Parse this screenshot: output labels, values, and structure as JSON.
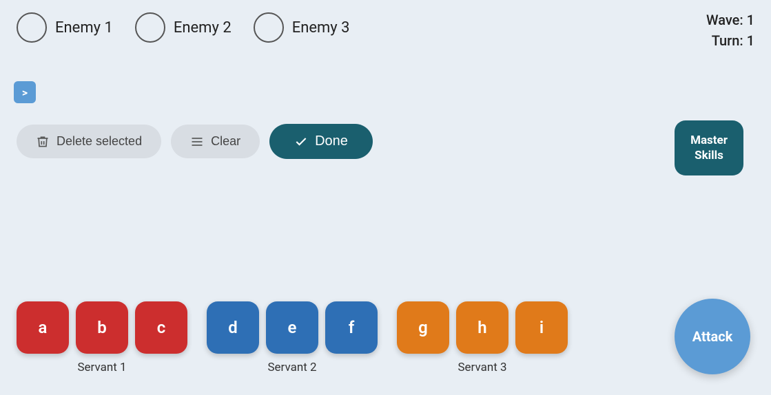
{
  "header": {
    "wave_label": "Wave: 1",
    "turn_label": "Turn: 1"
  },
  "enemies": [
    {
      "id": "enemy-1",
      "label": "Enemy 1"
    },
    {
      "id": "enemy-2",
      "label": "Enemy 2"
    },
    {
      "id": "enemy-3",
      "label": "Enemy 3"
    }
  ],
  "arrow_icon": ">",
  "action_bar": {
    "delete_label": "Delete selected",
    "clear_label": "Clear",
    "done_label": "Done"
  },
  "master_skills": {
    "label": "Master\nSkills"
  },
  "servants": [
    {
      "name": "Servant 1",
      "color": "red",
      "cards": [
        "a",
        "b",
        "c"
      ]
    },
    {
      "name": "Servant 2",
      "color": "blue",
      "cards": [
        "d",
        "e",
        "f"
      ]
    },
    {
      "name": "Servant 3",
      "color": "orange",
      "cards": [
        "g",
        "h",
        "i"
      ]
    }
  ],
  "attack_label": "Attack",
  "colors": {
    "accent_teal": "#1a5f6e",
    "card_red": "#cc2e2e",
    "card_blue": "#2e6fb5",
    "card_orange": "#e07a1a",
    "attack_blue": "#5b9bd5"
  }
}
